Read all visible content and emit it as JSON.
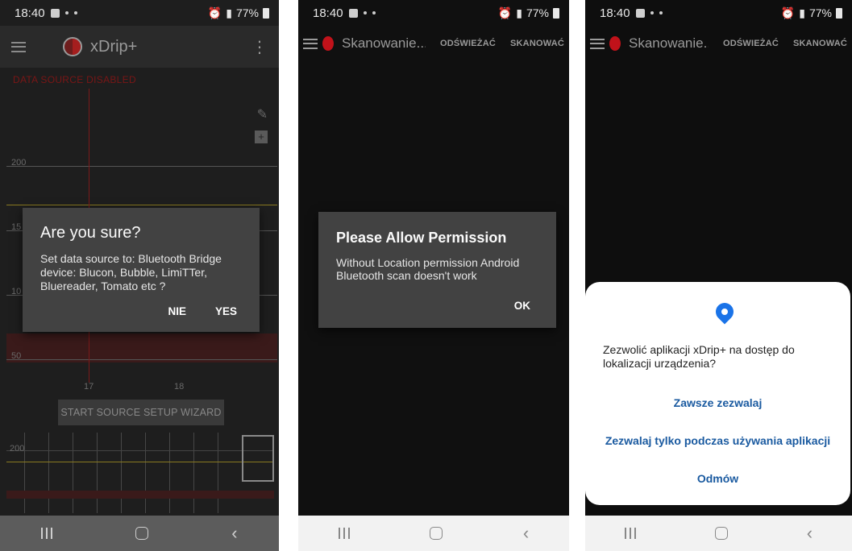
{
  "status_bar": {
    "time": "18:40",
    "battery": "77%"
  },
  "panel1": {
    "app_title": "xDrip+",
    "data_source_status": "DATA SOURCE DISABLED",
    "y_labels": [
      "200",
      "15",
      "10",
      "50"
    ],
    "x_labels": [
      "17",
      "18"
    ],
    "mini_y_label": "200",
    "wizard_button": "START SOURCE SETUP WIZARD",
    "dialog": {
      "title": "Are you sure?",
      "message": "Set data source to: Bluetooth Bridge device: Blucon, Bubble, LimiTTer, Bluereader, Tomato etc ?",
      "negative": "NIE",
      "positive": "YES"
    }
  },
  "panel2": {
    "toolbar_title": "Skanowanie...",
    "refresh_button": "ODŚWIEŻAĆ",
    "scan_button": "SKANOWAĆ",
    "dialog": {
      "title": "Please Allow Permission",
      "message": "Without Location permission Android Bluetooth scan doesn't work",
      "ok": "OK"
    }
  },
  "panel3": {
    "toolbar_title": "Skanowanie...",
    "refresh_button": "ODŚWIEŻAĆ",
    "scan_button": "SKANOWAĆ",
    "permission": {
      "message": "Zezwolić aplikacji xDrip+ na dostęp do lokalizacji urządzenia?",
      "always": "Zawsze zezwalaj",
      "while_using": "Zezwalaj tylko podczas używania aplikacji",
      "deny": "Odmów"
    }
  },
  "colors": {
    "accent_blue": "#1a73e8",
    "dialog_bg": "#424242",
    "xdrip_red": "#c1121a"
  },
  "icons": [
    "hamburger-icon",
    "xdrip-logo-icon",
    "overflow-menu-icon",
    "pencil-icon",
    "add-note-icon",
    "location-pin-icon",
    "recents-icon",
    "home-icon",
    "back-icon"
  ]
}
